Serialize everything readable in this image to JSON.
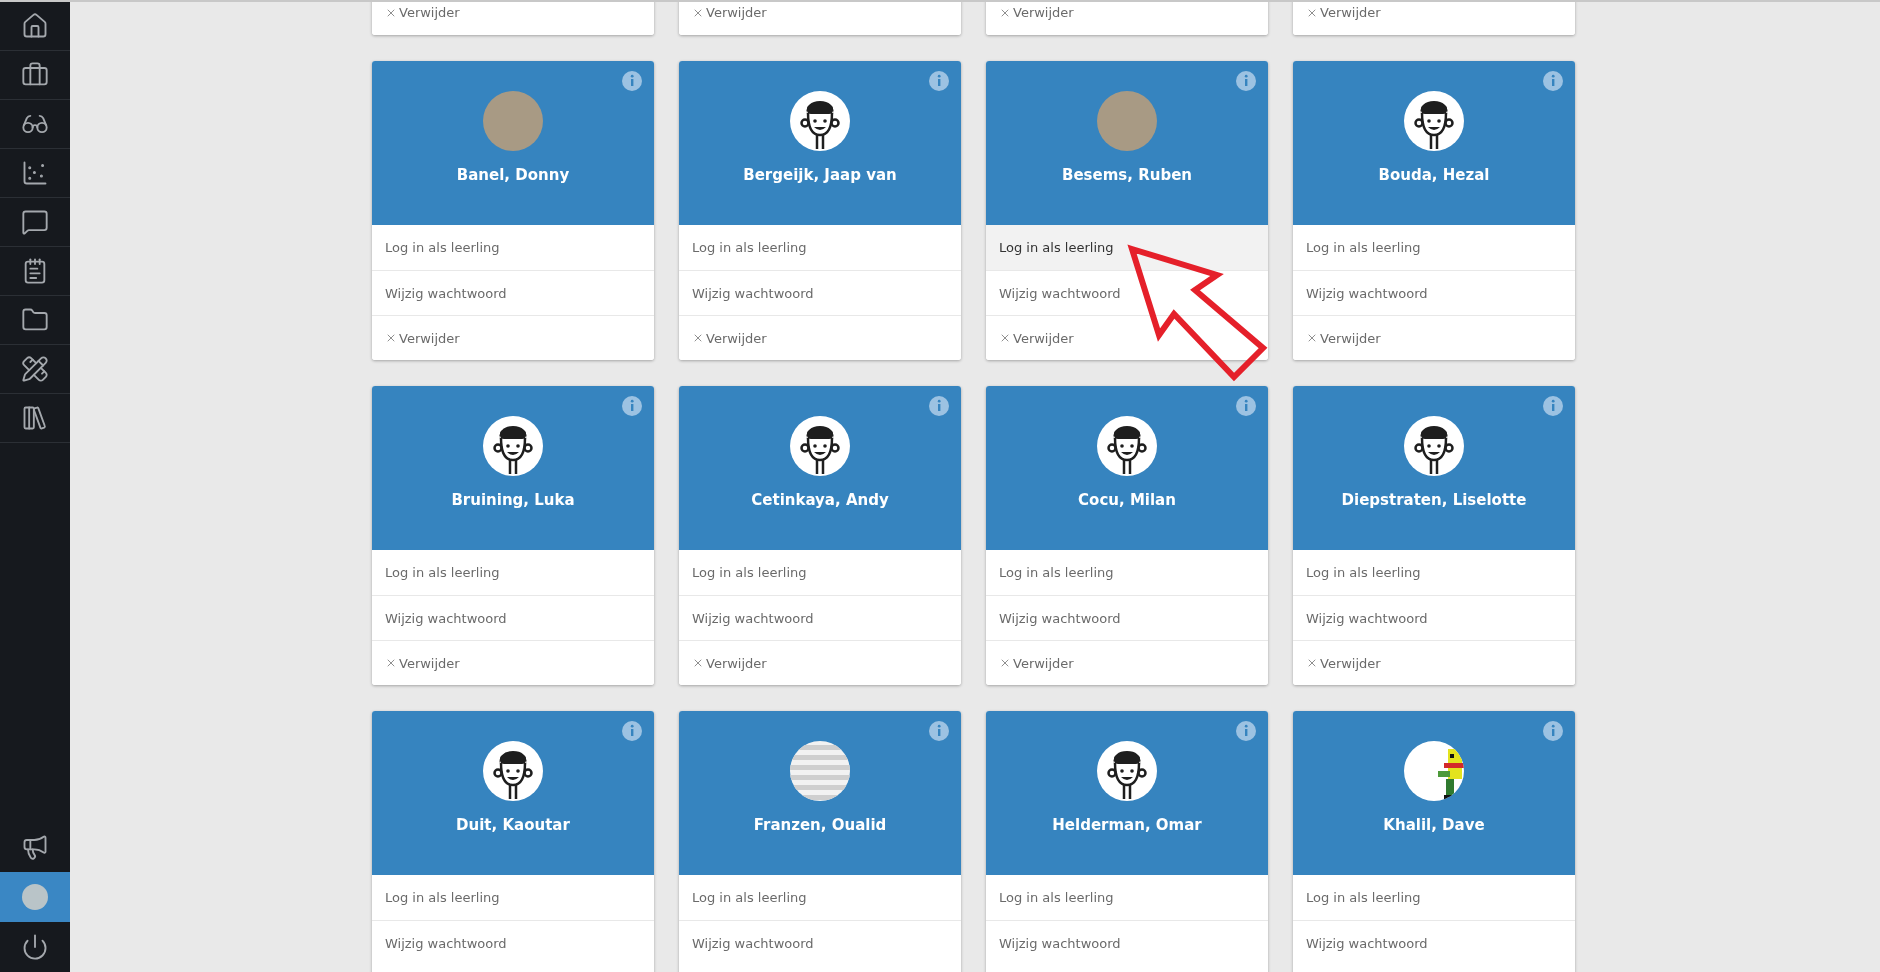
{
  "sidebar": {
    "items": [
      {
        "selected": false
      },
      {
        "selected": false
      },
      {
        "selected": false
      },
      {
        "selected": false
      },
      {
        "selected": false
      },
      {
        "selected": false
      },
      {
        "selected": false
      },
      {
        "selected": false
      },
      {
        "selected": false
      }
    ],
    "bottom_items": [
      {
        "kind": "icon",
        "selected": false
      },
      {
        "kind": "avatar",
        "selected": true
      },
      {
        "kind": "icon",
        "selected": false
      }
    ]
  },
  "top_row": [
    {
      "actions": [
        {
          "kind": "remove",
          "label": "Verwijder",
          "highlighted": false
        }
      ]
    },
    {
      "actions": [
        {
          "kind": "remove",
          "label": "Verwijder",
          "highlighted": false
        }
      ]
    },
    {
      "actions": [
        {
          "kind": "remove",
          "label": "Verwijder",
          "highlighted": false
        }
      ]
    },
    {
      "actions": [
        {
          "kind": "remove",
          "label": "Verwijder",
          "highlighted": false
        }
      ]
    }
  ],
  "rows": [
    [
      {
        "name": "Banel, Donny",
        "avatar": {
          "kind": "photo"
        },
        "actions": [
          {
            "kind": "link",
            "label": "Log in als leerling",
            "highlighted": false
          },
          {
            "kind": "link",
            "label": "Wijzig wachtwoord",
            "highlighted": false
          },
          {
            "kind": "remove",
            "label": "Verwijder",
            "highlighted": false
          }
        ]
      },
      {
        "name": "Bergeijk, Jaap van",
        "avatar": {
          "kind": "cartoon"
        },
        "actions": [
          {
            "kind": "link",
            "label": "Log in als leerling",
            "highlighted": false
          },
          {
            "kind": "link",
            "label": "Wijzig wachtwoord",
            "highlighted": false
          },
          {
            "kind": "remove",
            "label": "Verwijder",
            "highlighted": false
          }
        ]
      },
      {
        "name": "Besems, Ruben",
        "avatar": {
          "kind": "photo"
        },
        "actions": [
          {
            "kind": "link",
            "label": "Log in als leerling",
            "highlighted": true
          },
          {
            "kind": "link",
            "label": "Wijzig wachtwoord",
            "highlighted": false
          },
          {
            "kind": "remove",
            "label": "Verwijder",
            "highlighted": false
          }
        ]
      },
      {
        "name": "Bouda, Hezal",
        "avatar": {
          "kind": "cartoon"
        },
        "actions": [
          {
            "kind": "link",
            "label": "Log in als leerling",
            "highlighted": false
          },
          {
            "kind": "link",
            "label": "Wijzig wachtwoord",
            "highlighted": false
          },
          {
            "kind": "remove",
            "label": "Verwijder",
            "highlighted": false
          }
        ]
      }
    ],
    [
      {
        "name": "Bruining, Luka",
        "avatar": {
          "kind": "cartoon"
        },
        "actions": [
          {
            "kind": "link",
            "label": "Log in als leerling",
            "highlighted": false
          },
          {
            "kind": "link",
            "label": "Wijzig wachtwoord",
            "highlighted": false
          },
          {
            "kind": "remove",
            "label": "Verwijder",
            "highlighted": false
          }
        ]
      },
      {
        "name": "Cetinkaya, Andy",
        "avatar": {
          "kind": "cartoon"
        },
        "actions": [
          {
            "kind": "link",
            "label": "Log in als leerling",
            "highlighted": false
          },
          {
            "kind": "link",
            "label": "Wijzig wachtwoord",
            "highlighted": false
          },
          {
            "kind": "remove",
            "label": "Verwijder",
            "highlighted": false
          }
        ]
      },
      {
        "name": "Cocu, Milan",
        "avatar": {
          "kind": "cartoon"
        },
        "actions": [
          {
            "kind": "link",
            "label": "Log in als leerling",
            "highlighted": false
          },
          {
            "kind": "link",
            "label": "Wijzig wachtwoord",
            "highlighted": false
          },
          {
            "kind": "remove",
            "label": "Verwijder",
            "highlighted": false
          }
        ]
      },
      {
        "name": "Diepstraten, Liselotte",
        "avatar": {
          "kind": "cartoon"
        },
        "actions": [
          {
            "kind": "link",
            "label": "Log in als leerling",
            "highlighted": false
          },
          {
            "kind": "link",
            "label": "Wijzig wachtwoord",
            "highlighted": false
          },
          {
            "kind": "remove",
            "label": "Verwijder",
            "highlighted": false
          }
        ]
      }
    ],
    [
      {
        "name": "Duit, Kaoutar",
        "avatar": {
          "kind": "cartoon"
        },
        "actions": [
          {
            "kind": "link",
            "label": "Log in als leerling",
            "highlighted": false
          },
          {
            "kind": "link",
            "label": "Wijzig wachtwoord",
            "highlighted": false
          }
        ]
      },
      {
        "name": "Franzen, Oualid",
        "avatar": {
          "kind": "striped"
        },
        "actions": [
          {
            "kind": "link",
            "label": "Log in als leerling",
            "highlighted": false
          },
          {
            "kind": "link",
            "label": "Wijzig wachtwoord",
            "highlighted": false
          }
        ]
      },
      {
        "name": "Helderman, Omar",
        "avatar": {
          "kind": "cartoon"
        },
        "actions": [
          {
            "kind": "link",
            "label": "Log in als leerling",
            "highlighted": false
          },
          {
            "kind": "link",
            "label": "Wijzig wachtwoord",
            "highlighted": false
          }
        ]
      },
      {
        "name": "Khalil, Dave",
        "avatar": {
          "kind": "pixel"
        },
        "actions": [
          {
            "kind": "link",
            "label": "Log in als leerling",
            "highlighted": false
          },
          {
            "kind": "link",
            "label": "Wijzig wachtwoord",
            "highlighted": false
          }
        ]
      }
    ]
  ],
  "annotation": {
    "kind": "arrow"
  }
}
